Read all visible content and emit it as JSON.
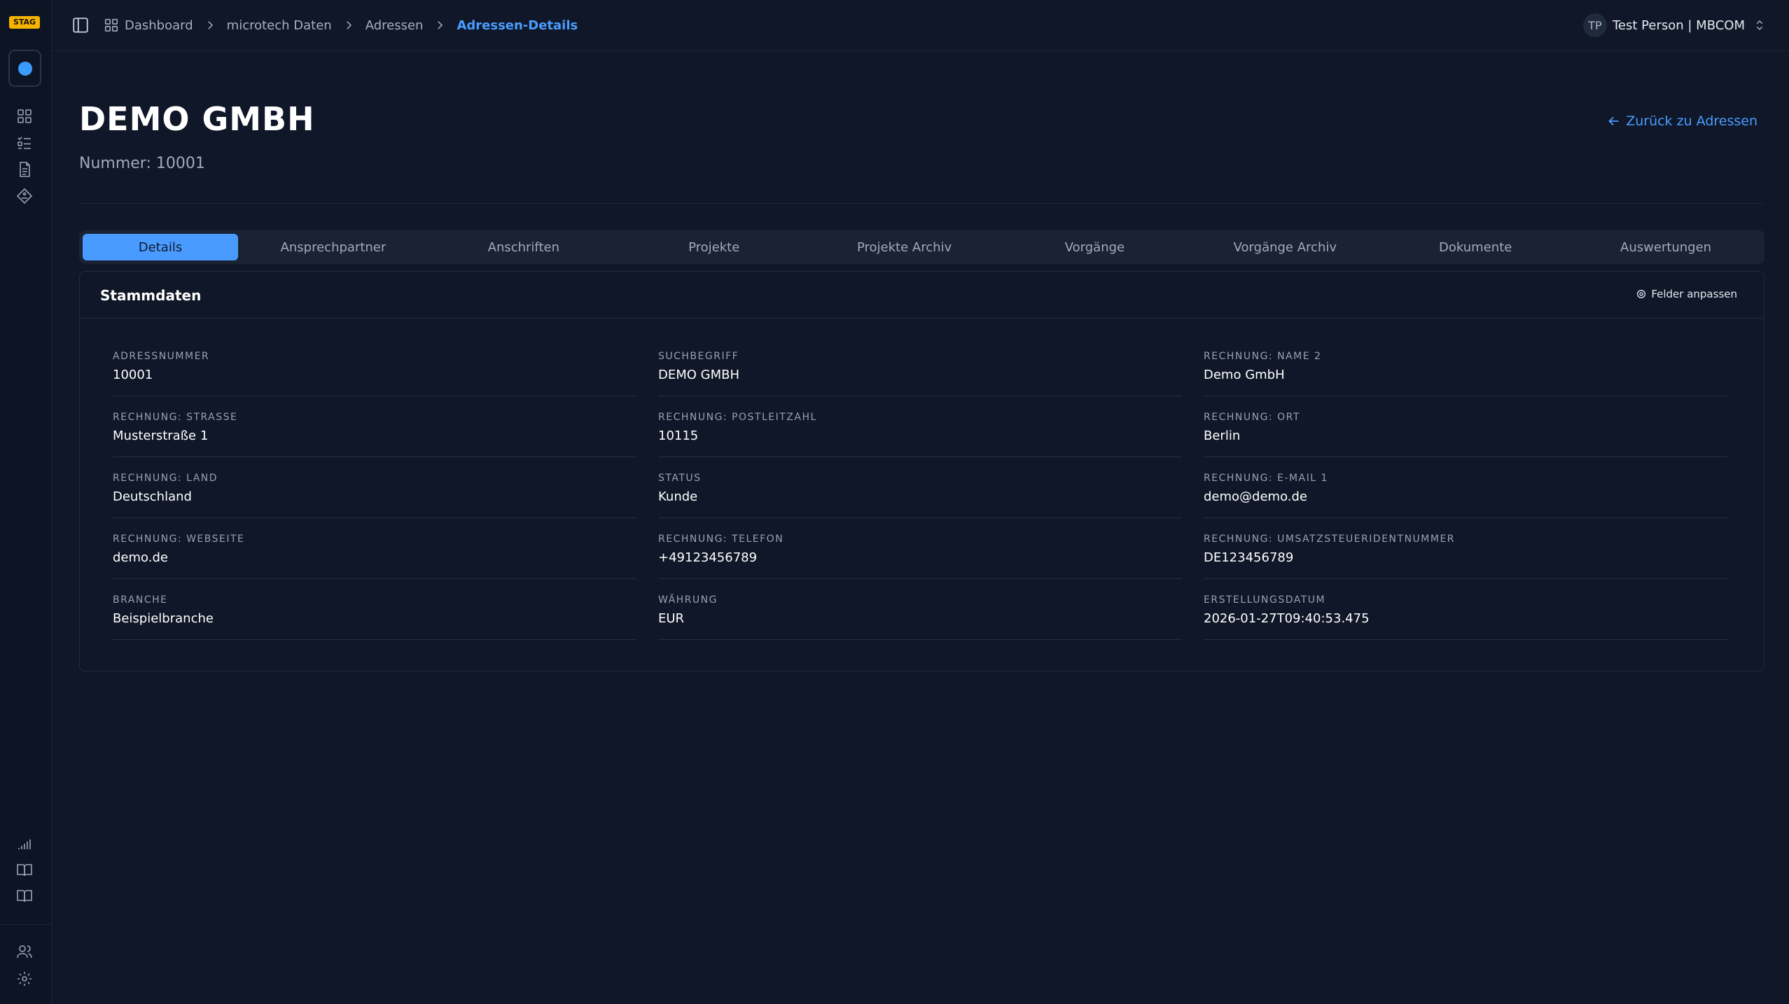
{
  "app": {
    "env_badge": "STAG"
  },
  "breadcrumb": {
    "items": [
      "Dashboard",
      "microtech Daten",
      "Adressen",
      "Adressen-Details"
    ]
  },
  "user": {
    "initials": "TP",
    "label": "Test Person | MBCOM"
  },
  "page": {
    "title": "DEMO GMBH",
    "subtitle": "Nummer: 10001",
    "back_label": "Zurück zu Adressen"
  },
  "tabs": [
    {
      "label": "Details",
      "active": true
    },
    {
      "label": "Ansprechpartner"
    },
    {
      "label": "Anschriften"
    },
    {
      "label": "Projekte"
    },
    {
      "label": "Projekte Archiv"
    },
    {
      "label": "Vorgänge"
    },
    {
      "label": "Vorgänge Archiv"
    },
    {
      "label": "Dokumente"
    },
    {
      "label": "Auswertungen"
    }
  ],
  "card": {
    "title": "Stammdaten",
    "customize_label": "Felder anpassen"
  },
  "fields": [
    {
      "label": "ADRESSNUMMER",
      "value": "10001"
    },
    {
      "label": "SUCHBEGRIFF",
      "value": "DEMO GMBH"
    },
    {
      "label": "RECHNUNG: NAME 2",
      "value": "Demo GmbH"
    },
    {
      "label": "RECHNUNG: STRASSE",
      "value": "Musterstraße 1"
    },
    {
      "label": "RECHNUNG: POSTLEITZAHL",
      "value": "10115"
    },
    {
      "label": "RECHNUNG: ORT",
      "value": "Berlin"
    },
    {
      "label": "RECHNUNG: LAND",
      "value": "Deutschland"
    },
    {
      "label": "STATUS",
      "value": "Kunde"
    },
    {
      "label": "RECHNUNG: E-MAIL 1",
      "value": "demo@demo.de"
    },
    {
      "label": "RECHNUNG: WEBSEITE",
      "value": "demo.de"
    },
    {
      "label": "RECHNUNG: TELEFON",
      "value": "+49123456789"
    },
    {
      "label": "RECHNUNG: UMSATZSTEUERIDENTNUMMER",
      "value": "DE123456789"
    },
    {
      "label": "BRANCHE",
      "value": "Beispielbranche"
    },
    {
      "label": "WÄHRUNG",
      "value": "EUR"
    },
    {
      "label": "ERSTELLUNGSDATUM",
      "value": "2026-01-27T09:40:53.475"
    }
  ],
  "colors": {
    "background": "#0f1728",
    "accent": "#4a9bff",
    "badge": "#f5b400"
  },
  "icons": {
    "sidebar": [
      "dashboard-icon",
      "list-check-icon",
      "document-icon",
      "diamond-tag-icon",
      "signal-icon",
      "book-open-icon",
      "book-icon",
      "users-icon",
      "gear-icon"
    ]
  }
}
